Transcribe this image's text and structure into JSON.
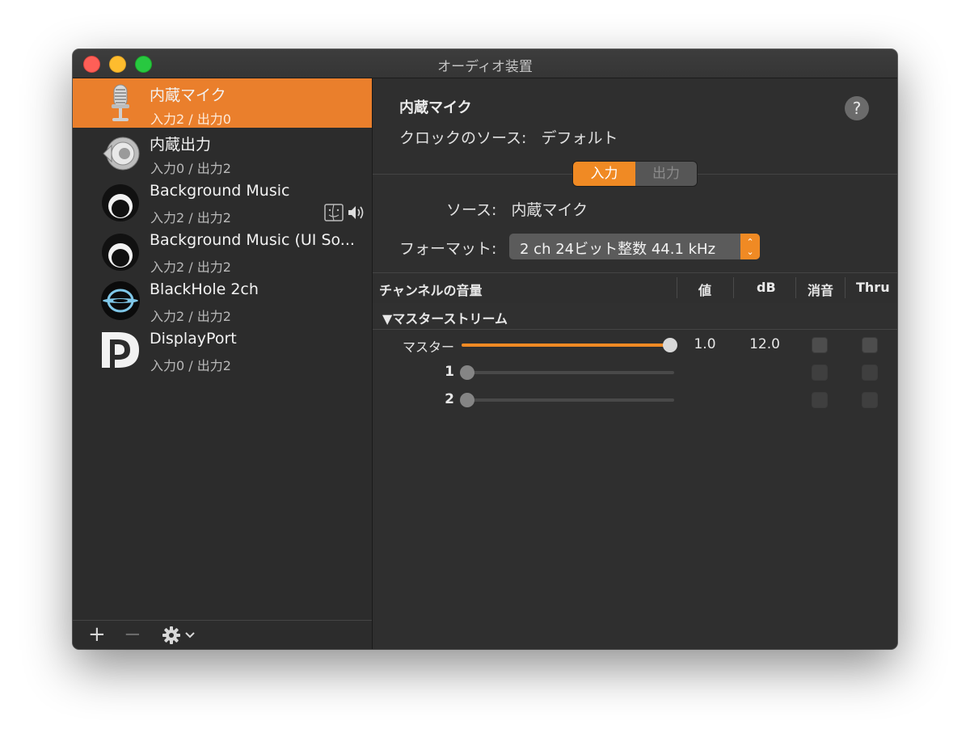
{
  "window": {
    "title": "オーディオ装置"
  },
  "devices": [
    {
      "name": "内蔵マイク",
      "io": "入力2 / 出力0",
      "icon": "microphone-icon",
      "selected": true
    },
    {
      "name": "内蔵出力",
      "io": "入力0 / 出力2",
      "icon": "speaker-icon",
      "selected": false
    },
    {
      "name": "Background Music",
      "io": "入力2 / 出力2",
      "icon": "background-music-icon",
      "selected": false
    },
    {
      "name": "Background Music (UI So...",
      "io": "入力2 / 出力2",
      "icon": "background-music-icon",
      "selected": false
    },
    {
      "name": "BlackHole 2ch",
      "io": "入力2 / 出力2",
      "icon": "blackhole-icon",
      "selected": false
    },
    {
      "name": "DisplayPort",
      "io": "入力0 / 出力2",
      "icon": "displayport-icon",
      "selected": false
    }
  ],
  "device_badges": {
    "finder": "finder-icon",
    "volume": "volume-icon"
  },
  "footer": {
    "add": "+",
    "remove": "−",
    "gear": "gear-icon"
  },
  "main": {
    "device_title": "内蔵マイク",
    "clock_label": "クロックのソース:",
    "clock_value": "デフォルト",
    "help": "?",
    "tabs": {
      "input": "入力",
      "output": "出力",
      "active": "input"
    },
    "source_label": "ソース:",
    "source_value": "内蔵マイク",
    "format_label": "フォーマット:",
    "format_value": "2 ch 24ビット整数 44.1 kHz"
  },
  "table": {
    "headers": {
      "channel": "チャンネルの音量",
      "value": "値",
      "db": "dB",
      "mute": "消音",
      "thru": "Thru"
    },
    "group": "▼マスターストリーム",
    "rows": [
      {
        "label": "マスター",
        "level": 1.0,
        "value": "1.0",
        "db": "12.0",
        "enabled": true
      },
      {
        "label": "1",
        "level": 0.0,
        "value": "",
        "db": "",
        "enabled": false
      },
      {
        "label": "2",
        "level": 0.0,
        "value": "",
        "db": "",
        "enabled": false
      }
    ]
  },
  "colors": {
    "accent": "#f08a24",
    "selection": "#ea7f2c"
  }
}
